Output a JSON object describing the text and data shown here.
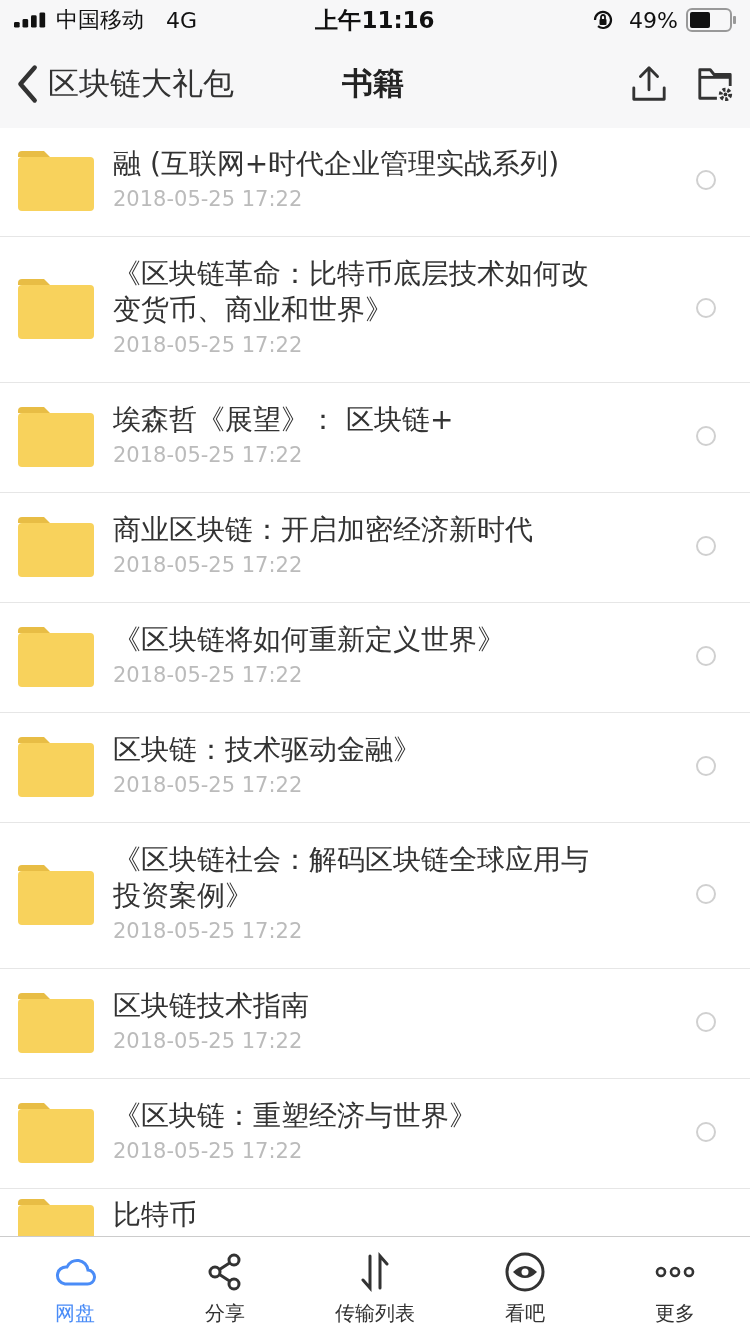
{
  "status_bar": {
    "carrier": "中国移动",
    "network": "4G",
    "time": "上午11:16",
    "battery": "49%"
  },
  "nav": {
    "back_label": "区块链大礼包",
    "title": "书籍"
  },
  "files": [
    {
      "name": "融 (互联网+时代企业管理实战系列)",
      "date": "2018-05-25 17:22",
      "selected": false
    },
    {
      "name": "《区块链革命：比特币底层技术如何改变货币、商业和世界》",
      "date": "2018-05-25 17:22",
      "selected": false
    },
    {
      "name": "埃森哲《展望》： 区块链+",
      "date": "2018-05-25 17:22",
      "selected": false
    },
    {
      "name": "商业区块链：开启加密经济新时代",
      "date": "2018-05-25 17:22",
      "selected": false
    },
    {
      "name": "《区块链将如何重新定义世界》",
      "date": "2018-05-25 17:22",
      "selected": false
    },
    {
      "name": "区块链：技术驱动金融》",
      "date": "2018-05-25 17:22",
      "selected": false
    },
    {
      "name": "《区块链社会：解码区块链全球应用与投资案例》",
      "date": "2018-05-25 17:22",
      "selected": false
    },
    {
      "name": "区块链技术指南",
      "date": "2018-05-25 17:22",
      "selected": false
    },
    {
      "name": "《区块链：重塑经济与世界》",
      "date": "2018-05-25 17:22",
      "selected": false
    },
    {
      "name": "比特币"
    }
  ],
  "tabs": [
    {
      "label": "网盘",
      "selected": true
    },
    {
      "label": "分享",
      "selected": false
    },
    {
      "label": "传输列表",
      "selected": false
    },
    {
      "label": "看吧",
      "selected": false
    },
    {
      "label": "更多",
      "selected": false
    }
  ]
}
